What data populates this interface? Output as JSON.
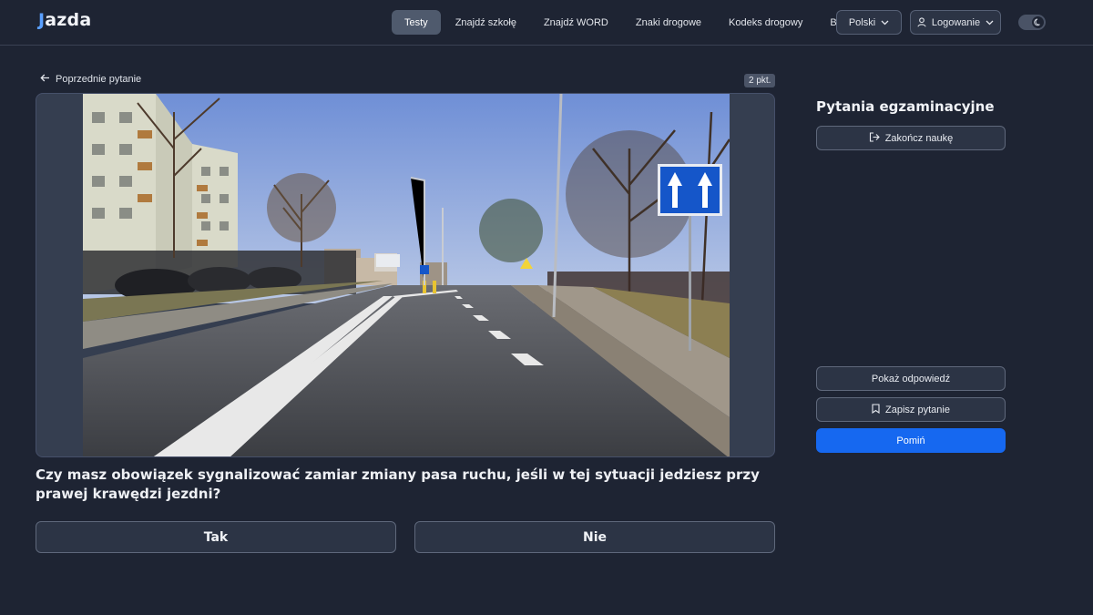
{
  "header": {
    "logo_j": "J",
    "logo_rest": "azda",
    "nav": [
      {
        "label": "Testy",
        "active": true
      },
      {
        "label": "Znajdź szkołę",
        "active": false
      },
      {
        "label": "Znajdź WORD",
        "active": false
      },
      {
        "label": "Znaki drogowe",
        "active": false
      },
      {
        "label": "Kodeks drogowy",
        "active": false
      },
      {
        "label": "Blog",
        "active": false
      }
    ],
    "language_label": "Polski",
    "login_label": "Logowanie",
    "icons": {
      "language_chevron": "chevron-down-icon",
      "login_user": "user-icon",
      "theme": "moon-icon"
    }
  },
  "main": {
    "back_label": "Poprzednie pytanie",
    "points_badge": "2 pkt.",
    "question": "Czy masz obowiązek sygnalizować zamiar zmiany pasa ruchu, jeśli w tej sytuacji jedziesz przy prawej krawędzi jezdni?",
    "answers": [
      "Tak",
      "Nie"
    ]
  },
  "sidebar": {
    "title": "Pytania egzaminacyjne",
    "end_label": "Zakończ naukę",
    "show_answer_label": "Pokaż odpowiedź",
    "save_label": "Zapisz pytanie",
    "skip_label": "Pomiń"
  },
  "colors": {
    "background": "#1e2433",
    "primary": "#1668f0",
    "sign_blue": "#1556c9"
  }
}
